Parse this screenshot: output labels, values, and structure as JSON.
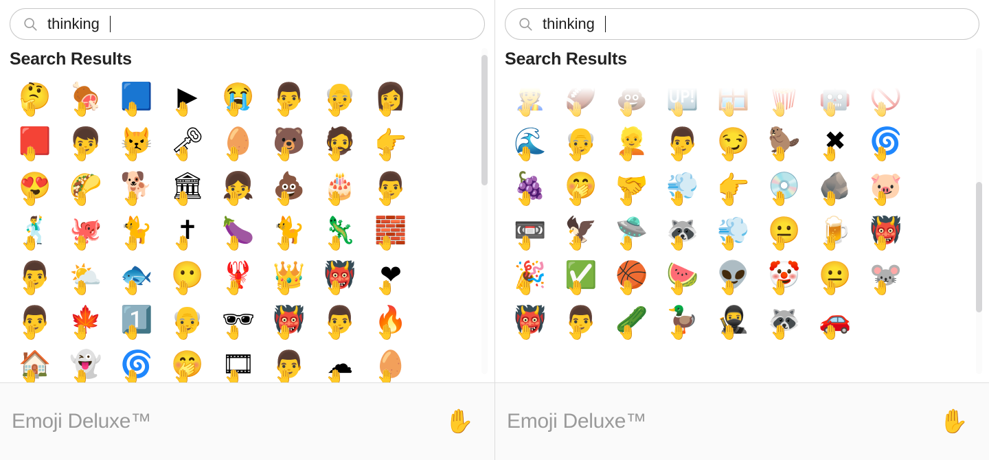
{
  "app": {
    "name": "Emoji Deluxe",
    "footer_title": "Emoji Deluxe™",
    "footer_emoji": "✋",
    "footer_emoji_name": "raised-hand-emoji",
    "divider_color": "#dcdcdc",
    "footer_bg": "#fafafa",
    "text_color": "#232323",
    "muted_color": "#9a9a9a",
    "scrollbar_thumb_color": "#d6d6d8",
    "scrollbar_track_color": "#fbfbfb"
  },
  "search": {
    "value": "thinking",
    "placeholder": "Search emoji",
    "icon": "search-icon",
    "caret_visible": true
  },
  "results": {
    "heading": "Search Results"
  },
  "panels": [
    {
      "id": "left",
      "label": "Emoji picker (before)",
      "scroll_position": "top",
      "scrollbar": {
        "thumb_top_pct": 2,
        "thumb_height_pct": 40
      },
      "rows": [
        [
          "🤔",
          "🍖",
          "🟦",
          "▶",
          "😭",
          "👨",
          "👴",
          "👩",
          "🟥"
        ],
        [
          "👦",
          "😾",
          "🗝",
          "🥚",
          "🐻",
          "🧔",
          "👉",
          "😍",
          "🌮"
        ],
        [
          "🐕",
          "🏛",
          "👧",
          "💩",
          "🎂",
          "👨",
          "🕺",
          "🐙",
          "🐈"
        ],
        [
          "✝",
          "🍆",
          "🐈",
          "🦎",
          "🧱",
          "👨",
          "⛅",
          "🐟",
          "😶"
        ],
        [
          "🦞",
          "👑",
          "👹",
          "❤",
          "👨",
          "🍁",
          "1️⃣",
          "👴",
          "🕶"
        ],
        [
          "👹",
          "👨",
          "🔥",
          "🏠",
          "👻",
          "🌀",
          "🤭",
          "🎞",
          "👨"
        ],
        [
          "☁",
          "🥚",
          "🙂",
          "🎞",
          "🥚",
          "🙃",
          "👩",
          "👴",
          "🟥"
        ]
      ]
    },
    {
      "id": "right",
      "label": "Emoji picker (after)",
      "scroll_position": "scrolled",
      "scrollbar": {
        "thumb_top_pct": 41,
        "thumb_height_pct": 40
      },
      "rows": [
        [
          "👌",
          "🔍",
          "🐿",
          "🎬",
          "🍔",
          "🤪",
          "👨",
          "👻",
          "🥫"
        ],
        [
          "🏴",
          "🤸",
          "👨",
          "🧀",
          "💳",
          "🌈",
          "👴",
          "👷",
          "🏈"
        ],
        [
          "💩",
          "🆙",
          "🪟",
          "🍿",
          "🤖",
          "🚫",
          "🌊",
          "👴",
          "👱"
        ],
        [
          "👨",
          "😏",
          "🦫",
          "✖",
          "🌀",
          "🍇",
          "🤭",
          "🤝",
          "💨"
        ],
        [
          "👉",
          "💿",
          "🪨",
          "🐷",
          "📼",
          "🦅",
          "🛸",
          "🦝",
          "💨"
        ],
        [
          "😐",
          "🍺",
          "👹",
          "🎉",
          "✅",
          "🏀",
          "🍉",
          "👽",
          "🤡"
        ],
        [
          "😐",
          "🐭",
          "👹",
          "👨",
          "🥒",
          "🦆",
          "🥷",
          "🦝",
          "🚗"
        ]
      ]
    }
  ],
  "thinking_hand": "🤚"
}
